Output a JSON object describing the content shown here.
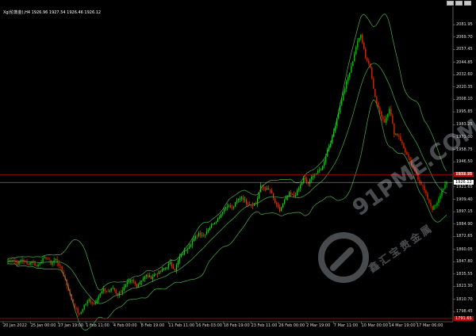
{
  "window": {
    "symbol_info": "Xg(伦敦金),H4",
    "ohlc": "1926.96 1927.54 1926.46 1926.12"
  },
  "price_axis": {
    "ticks": [
      "2081.95",
      "2069.70",
      "2057.45",
      "2044.85",
      "2032.60",
      "2020.35",
      "2008.10",
      "1995.85",
      "1983.25",
      "1971.00",
      "1958.75",
      "1946.50",
      "1934.25",
      "1921.65",
      "1909.40",
      "1897.15",
      "1884.90",
      "1872.65",
      "1860.05",
      "1847.80",
      "1835.55",
      "1823.30",
      "1810.70",
      "1798.45"
    ],
    "current_price": "1926.12",
    "upper_line_price": "1933.90",
    "lower_line_price": "1791.65"
  },
  "time_axis": {
    "ticks": [
      "20 Jan 2022",
      "25 Jan 00:00",
      "27 Jan 19:00",
      "1 Feb 11:00",
      "4 Feb 00:00",
      "8 Feb 19:00",
      "11 Feb 11:00",
      "16 Feb 03:00",
      "18 Feb 19:00",
      "23 Feb 11:00",
      "26 Feb 00:00",
      "2 Mar 19:00",
      "7 Mar 11:00",
      "10 Mar 00:00",
      "14 Mar 19:00",
      "17 Mar 06:00"
    ]
  },
  "watermark": {
    "brand": "91PME.COM",
    "subtitle": "鑫汇宝贵金属"
  },
  "colors": {
    "background": "#000000",
    "bull_candle": "#00e000",
    "bear_candle": "#ff2a00",
    "bands": "#4cae4c",
    "hline": "#c00000",
    "current_line": "#b0b0b0"
  },
  "chart_data": {
    "type": "candlestick",
    "y_range": [
      1790,
      2086
    ],
    "hlines": [
      1933.9,
      1926.12,
      1791.65
    ],
    "close_path": [
      1848,
      1850,
      1846,
      1850,
      1845,
      1848,
      1843,
      1849,
      1852,
      1846,
      1850,
      1842,
      1830,
      1815,
      1803,
      1795,
      1805,
      1810,
      1806,
      1814,
      1820,
      1818,
      1822,
      1815,
      1820,
      1826,
      1829,
      1824,
      1830,
      1834,
      1832,
      1836,
      1838,
      1842,
      1846,
      1840,
      1852,
      1858,
      1864,
      1870,
      1876,
      1874,
      1880,
      1886,
      1890,
      1898,
      1904,
      1900,
      1908,
      1912,
      1906,
      1904,
      1905,
      1922,
      1920,
      1918,
      1906,
      1898,
      1908,
      1915,
      1912,
      1920,
      1930,
      1925,
      1934,
      1936,
      1942,
      1958,
      1970,
      1990,
      2008,
      2025,
      2040,
      2060,
      2073,
      2050,
      2040,
      2010,
      1995,
      1986,
      2000,
      1975,
      1972,
      1960,
      1950,
      1940,
      1930,
      1922,
      1910,
      1900,
      1905,
      1918,
      1926
    ]
  }
}
